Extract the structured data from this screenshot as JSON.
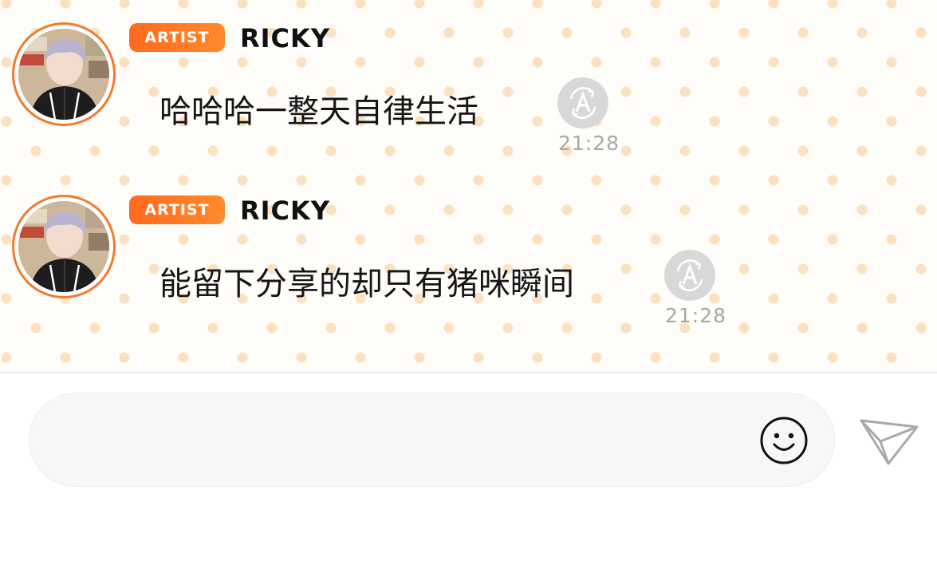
{
  "chat": {
    "messages": [
      {
        "badge": "ARTIST",
        "sender": "RICKY",
        "text": "哈哈哈一整天自律生活",
        "time": "21:28",
        "translate_icon": "translate-icon"
      },
      {
        "badge": "ARTIST",
        "sender": "RICKY",
        "text": "能留下分享的却只有猪咪瞬间",
        "time": "21:28",
        "translate_icon": "translate-icon"
      }
    ]
  },
  "composer": {
    "input_value": "",
    "input_placeholder": "",
    "emoji_icon": "smiley-face-icon",
    "send_icon": "paper-plane-icon"
  },
  "colors": {
    "accent": "#ff6a1e",
    "avatar_ring": "#f07a2e",
    "dots": "#fbe1bf",
    "timestamp": "#a8a8a8"
  }
}
